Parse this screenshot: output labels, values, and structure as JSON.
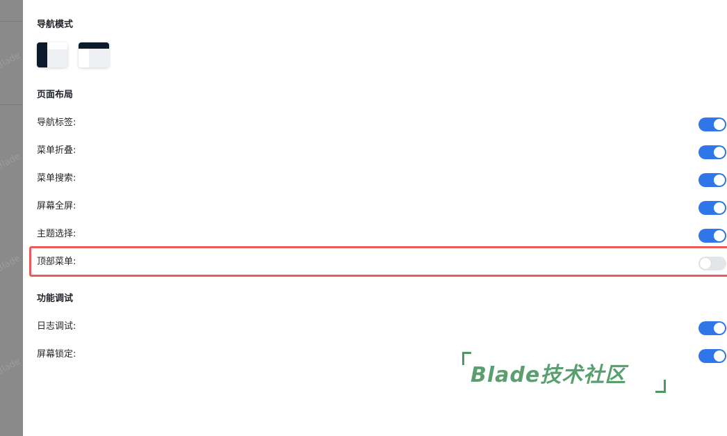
{
  "backdrop": {
    "watermark": "Blade"
  },
  "sections": {
    "nav_mode": {
      "title": "导航模式"
    },
    "layout": {
      "title": "页面布局",
      "items": [
        {
          "label": "导航标签:",
          "on": true
        },
        {
          "label": "菜单折叠:",
          "on": true
        },
        {
          "label": "菜单搜索:",
          "on": true
        },
        {
          "label": "屏幕全屏:",
          "on": true
        },
        {
          "label": "主题选择:",
          "on": true
        },
        {
          "label": "顶部菜单:",
          "on": false
        }
      ]
    },
    "debug": {
      "title": "功能调试",
      "items": [
        {
          "label": "日志调试:",
          "on": true
        },
        {
          "label": "屏幕锁定:",
          "on": true
        }
      ]
    }
  },
  "brand": {
    "text": "Blade技术社区"
  },
  "colors": {
    "switch_on": "#2f76e9",
    "switch_off": "#e3e5e9",
    "highlight": "#ec5a5a",
    "brand": "#5aa06e"
  }
}
